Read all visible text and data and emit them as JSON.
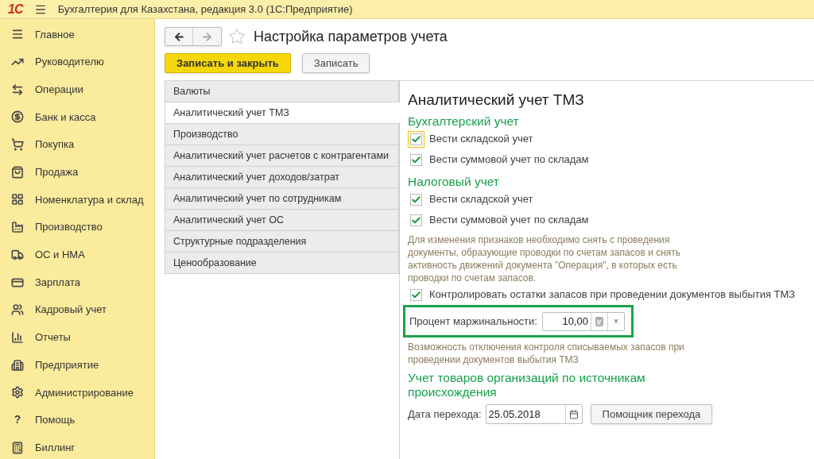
{
  "app_bar": {
    "logo": "1С",
    "title": "Бухгалтерия для Казахстана, редакция 3.0  (1С:Предприятие)"
  },
  "sidebar": {
    "items": [
      {
        "label": "Главное"
      },
      {
        "label": "Руководителю"
      },
      {
        "label": "Операции"
      },
      {
        "label": "Банк и касса"
      },
      {
        "label": "Покупка"
      },
      {
        "label": "Продажа"
      },
      {
        "label": "Номенклатура и склад"
      },
      {
        "label": "Производство"
      },
      {
        "label": "ОС и НМА"
      },
      {
        "label": "Зарплата"
      },
      {
        "label": "Кадровый учет"
      },
      {
        "label": "Отчеты"
      },
      {
        "label": "Предприятие"
      },
      {
        "label": "Администрирование"
      },
      {
        "label": "Помощь",
        "glyph": "?"
      },
      {
        "label": "Биллинг"
      }
    ]
  },
  "form": {
    "title": "Настройка параметров учета",
    "favorite": false,
    "buttons": [
      {
        "label": "Записать и закрыть",
        "kind": "primary"
      },
      {
        "label": "Записать",
        "kind": "default"
      }
    ],
    "sections": [
      {
        "label": "Валюты",
        "selected": false
      },
      {
        "label": "Аналитический учет ТМЗ",
        "selected": true
      },
      {
        "label": "Производство",
        "selected": false
      },
      {
        "label": "Аналитический учет расчетов с контрагентами",
        "selected": false
      },
      {
        "label": "Аналитический учет доходов/затрат",
        "selected": false
      },
      {
        "label": "Аналитический учет по сотрудникам",
        "selected": false
      },
      {
        "label": "Аналитический учет ОС",
        "selected": false
      },
      {
        "label": "Структурные подразделения",
        "selected": false
      },
      {
        "label": "Ценообразование",
        "selected": false
      }
    ],
    "panel": {
      "title": "Аналитический учет ТМЗ",
      "groups": [
        {
          "heading": "Бухгалтерский учет",
          "checkboxes": [
            {
              "label": "Вести складской учет",
              "checked": true,
              "focused": true
            },
            {
              "label": "Вести суммовой учет по складам",
              "checked": true,
              "focused": false
            }
          ]
        },
        {
          "heading": "Налоговый учет",
          "checkboxes": [
            {
              "label": "Вести складской учет",
              "checked": true,
              "focused": false
            },
            {
              "label": "Вести суммовой учет по складам",
              "checked": true,
              "focused": false
            }
          ]
        }
      ],
      "note": "Для изменения признаков необходимо снять с проведения документы, образующие проводки по счетам запасов и снять активность движений документа \"Операция\", в которых есть проводки по счетам запасов.",
      "control_checkbox": {
        "label": "Контролировать остатки запасов при проведении документов выбытия ТМЗ",
        "checked": true,
        "focused": false
      },
      "margin_field": {
        "label": "Процент маржинальности:",
        "value": "10,00",
        "clear": "×",
        "highlighted": true
      },
      "margin_note": "Возможность отключения контроля списываемых запасов при проведении документов выбытия ТМЗ",
      "origin": {
        "heading": "Учет товаров организаций по источникам происхождения",
        "date_label": "Дата перехода:",
        "date_value": "25.05.2018",
        "button": "Помощник перехода"
      }
    }
  }
}
